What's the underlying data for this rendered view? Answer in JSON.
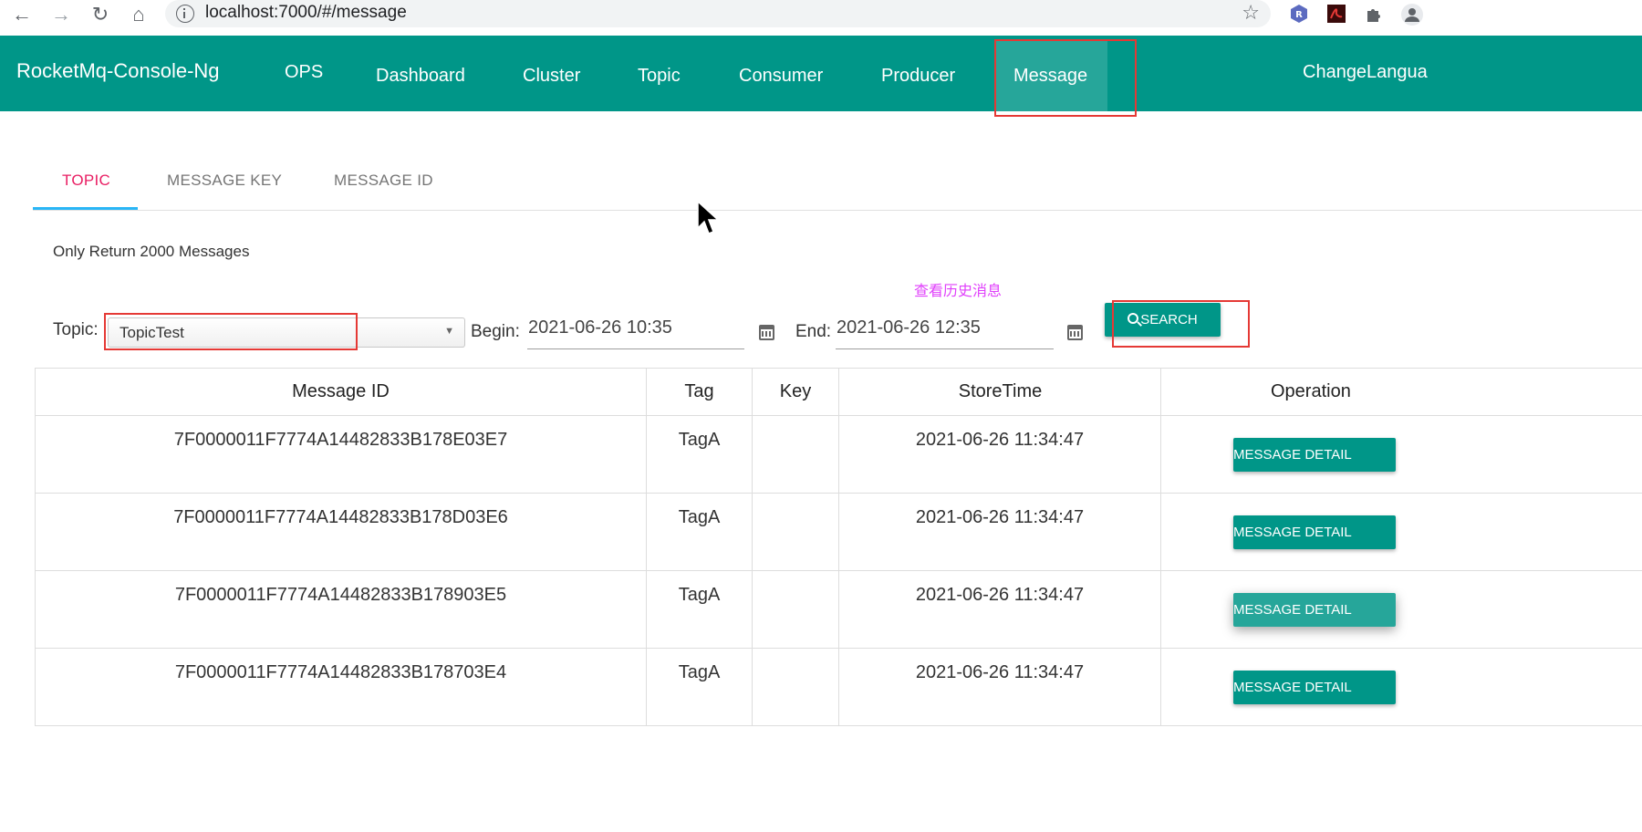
{
  "browser": {
    "url": "localhost:7000/#/message",
    "back_icon": "arrow-left-icon",
    "forward_icon": "arrow-right-icon",
    "reload_icon": "reload-icon",
    "home_icon": "home-icon",
    "extensions": [
      "r-extension-icon",
      "pdf-extension-icon",
      "puzzle-icon",
      "profile-icon"
    ],
    "r_ext_label": "R"
  },
  "navbar": {
    "brand": "RocketMq-Console-Ng",
    "items": [
      "OPS",
      "Dashboard",
      "Cluster",
      "Topic",
      "Consumer",
      "Producer",
      "Message"
    ],
    "active": "Message",
    "change_language": "ChangeLangua",
    "color": "#009688"
  },
  "tabs": {
    "items": [
      "TOPIC",
      "MESSAGE KEY",
      "MESSAGE ID"
    ],
    "active": "TOPIC",
    "active_color": "#e91e63"
  },
  "note": "Only Return 2000 Messages",
  "annotation": "查看历史消息",
  "filters": {
    "topic_label": "Topic:",
    "topic_value": "TopicTest",
    "begin_label": "Begin:",
    "begin_value": "2021-06-26 10:35",
    "end_label": "End:",
    "end_value": "2021-06-26 12:35",
    "search_label": "SEARCH"
  },
  "table": {
    "headers": [
      "Message ID",
      "Tag",
      "Key",
      "StoreTime",
      "Operation"
    ],
    "rows": [
      {
        "id": "7F0000011F7774A14482833B178E03E7",
        "tag": "TagA",
        "key": "",
        "store_time": "2021-06-26 11:34:47",
        "action": "MESSAGE DETAIL"
      },
      {
        "id": "7F0000011F7774A14482833B178D03E6",
        "tag": "TagA",
        "key": "",
        "store_time": "2021-06-26 11:34:47",
        "action": "MESSAGE DETAIL"
      },
      {
        "id": "7F0000011F7774A14482833B178903E5",
        "tag": "TagA",
        "key": "",
        "store_time": "2021-06-26 11:34:47",
        "action": "MESSAGE DETAIL"
      },
      {
        "id": "7F0000011F7774A14482833B178703E4",
        "tag": "TagA",
        "key": "",
        "store_time": "2021-06-26 11:34:47",
        "action": "MESSAGE DETAIL"
      }
    ]
  },
  "highlight_color": "#e53935"
}
